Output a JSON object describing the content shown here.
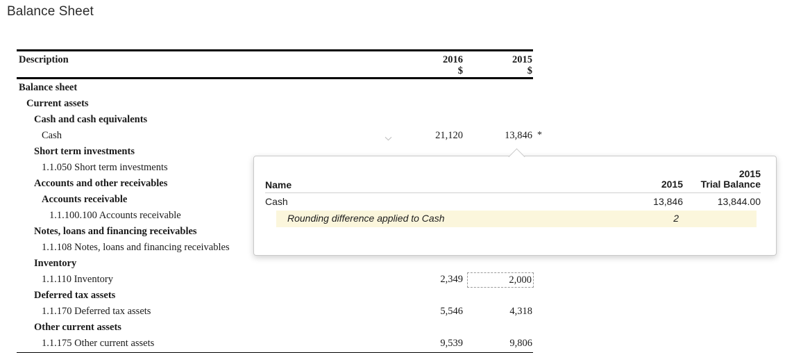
{
  "page": {
    "title": "Balance Sheet"
  },
  "table": {
    "columns": {
      "description": "Description",
      "year_2016": "2016",
      "year_2016_currency": "$",
      "year_2015": "2015",
      "year_2015_currency": "$"
    },
    "rows": [
      {
        "label": "Balance sheet",
        "indent": 0,
        "group": true,
        "chevron": true,
        "v2016": "",
        "v2015": ""
      },
      {
        "label": "Current assets",
        "indent": 1,
        "group": true,
        "chevron": true,
        "v2016": "",
        "v2015": ""
      },
      {
        "label": "Cash and cash equivalents",
        "indent": 2,
        "group": true,
        "chevron": true,
        "v2016": "",
        "v2015": ""
      },
      {
        "label": "Cash",
        "indent": 3,
        "group": false,
        "chevron": false,
        "v2016": "21,120",
        "v2015": "13,846",
        "marker": "*",
        "row_chevron": true
      },
      {
        "label": "Short term investments",
        "indent": 2,
        "group": true,
        "chevron": true,
        "v2016": "",
        "v2015": ""
      },
      {
        "label": "1.1.050 Short term investments",
        "indent": 3,
        "group": false,
        "chevron": false,
        "v2016": "",
        "v2015": ""
      },
      {
        "label": "Accounts and other receivables",
        "indent": 2,
        "group": true,
        "chevron": true,
        "v2016": "",
        "v2015": ""
      },
      {
        "label": "Accounts receivable",
        "indent": 3,
        "group": true,
        "chevron": true,
        "v2016": "",
        "v2015": ""
      },
      {
        "label": "1.1.100.100 Accounts receivable",
        "indent": 4,
        "group": false,
        "chevron": false,
        "v2016": "",
        "v2015": ""
      },
      {
        "label": "Notes, loans and financing receivables",
        "indent": 2,
        "group": true,
        "chevron": true,
        "v2016": "",
        "v2015": ""
      },
      {
        "label": "1.1.108 Notes, loans and financing receivables",
        "indent": 3,
        "group": false,
        "chevron": false,
        "v2016": "",
        "v2015": ""
      },
      {
        "label": "Inventory",
        "indent": 2,
        "group": true,
        "chevron": true,
        "v2016": "",
        "v2015": ""
      },
      {
        "label": "1.1.110 Inventory",
        "indent": 3,
        "group": false,
        "chevron": false,
        "v2016": "2,349",
        "v2015": "2,000",
        "selected_2015": true
      },
      {
        "label": "Deferred tax assets",
        "indent": 2,
        "group": true,
        "chevron": true,
        "v2016": "",
        "v2015": ""
      },
      {
        "label": "1.1.170 Deferred tax assets",
        "indent": 3,
        "group": false,
        "chevron": false,
        "v2016": "5,546",
        "v2015": "4,318"
      },
      {
        "label": "Other current assets",
        "indent": 2,
        "group": true,
        "chevron": true,
        "v2016": "",
        "v2015": ""
      },
      {
        "label": "1.1.175 Other current assets",
        "indent": 3,
        "group": false,
        "chevron": false,
        "v2016": "9,539",
        "v2015": "9,806"
      }
    ]
  },
  "popover": {
    "columns": {
      "name": "Name",
      "year_2015": "2015",
      "trial_balance_year": "2015",
      "trial_balance_label": "Trial Balance"
    },
    "rows": [
      {
        "name": "Cash",
        "v2015": "13,846",
        "trial_balance": "13,844.00",
        "highlight": false
      },
      {
        "name": "Rounding difference applied to Cash",
        "v2015": "2",
        "trial_balance": "",
        "highlight": true
      }
    ],
    "highlight_color": "#fbf6dc"
  },
  "icons": {
    "chevron_down": "chevron-down-icon",
    "asterisk": "asterisk-icon"
  }
}
